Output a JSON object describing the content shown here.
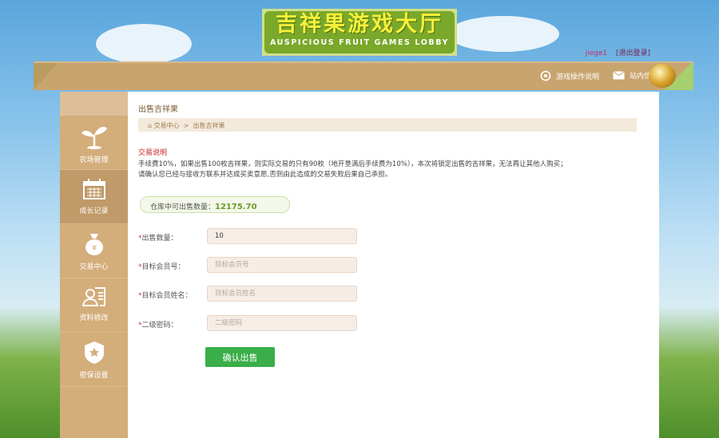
{
  "logo": {
    "title_cn": "吉祥果游戏大厅",
    "title_en": "AUSPICIOUS FRUIT GAMES LOBBY"
  },
  "user": {
    "name": "jiege1",
    "logout": "[退出登录]"
  },
  "header": {
    "guide": "游戏操作说明",
    "messages": "站内信"
  },
  "sidebar": {
    "items": [
      {
        "label": "农场管理",
        "icon": "sprout-icon"
      },
      {
        "label": "成长记录",
        "icon": "calendar-icon",
        "active": true
      },
      {
        "label": "交易中心",
        "icon": "money-bag-icon"
      },
      {
        "label": "资料修改",
        "icon": "profile-card-icon"
      },
      {
        "label": "密保设置",
        "icon": "shield-badge-icon"
      }
    ]
  },
  "main": {
    "title": "出售吉祥果",
    "breadcrumb": {
      "home": "交易中心",
      "sep": ">",
      "current": "出售吉祥果"
    },
    "note_title": "交易说明",
    "note_text": "手续费10%，如果出售100枚吉祥果，则实际交易的只有90枚（地开垦满后手续费为10%），本次将锁定出售的吉祥果，无法再让其他人购买；请确认您已经与接收方联系并达成买卖意愿,否则由此造成的交易失败后果自己承担。",
    "stock_label": "仓库中可出售数量：",
    "stock_value": "12175.70",
    "form": [
      {
        "label": "出售数量：",
        "value": "10",
        "placeholder": ""
      },
      {
        "label": "目标会员号：",
        "value": "",
        "placeholder": "目标会员号"
      },
      {
        "label": "目标会员姓名：",
        "value": "",
        "placeholder": "目标会员姓名"
      },
      {
        "label": "二级密码：",
        "value": "",
        "placeholder": "二级密码"
      }
    ],
    "required_mark": "*",
    "submit": "确认出售"
  },
  "colors": {
    "sidebar": "#d3ad7a",
    "header": "#c8a46f",
    "submit": "#3aae48"
  }
}
